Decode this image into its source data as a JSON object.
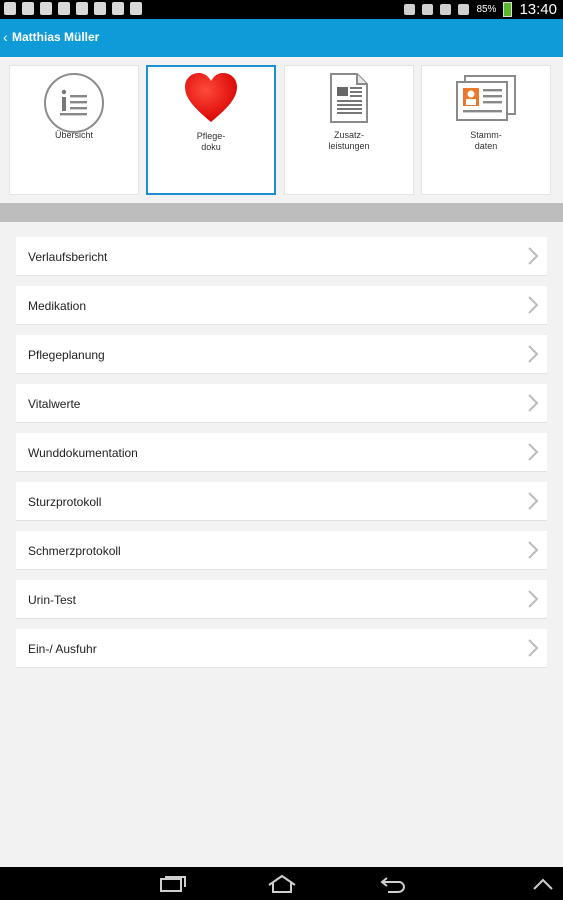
{
  "status_bar": {
    "battery_percent": "85%",
    "time": "13:40",
    "battery_color": "#5cb82b"
  },
  "header": {
    "title": "Matthias Müller",
    "background": "#0f9bd7"
  },
  "tiles": [
    {
      "label_lines": [
        "Übersicht"
      ],
      "icon": "info-list-icon",
      "selected": false
    },
    {
      "label_lines": [
        "Pflege-",
        "doku"
      ],
      "icon": "heart-icon",
      "selected": true
    },
    {
      "label_lines": [
        "Zusatz-",
        "leistungen"
      ],
      "icon": "document-icon",
      "selected": false
    },
    {
      "label_lines": [
        "Stamm-",
        "daten"
      ],
      "icon": "id-card-icon",
      "selected": false
    }
  ],
  "menu": {
    "items": [
      {
        "label": "Verlaufsbericht"
      },
      {
        "label": "Medikation"
      },
      {
        "label": "Pflegeplanung"
      },
      {
        "label": "Vitalwerte"
      },
      {
        "label": "Wunddokumentation"
      },
      {
        "label": "Sturzprotokoll"
      },
      {
        "label": "Schmerzprotokoll"
      },
      {
        "label": "Urin-Test"
      },
      {
        "label": "Ein-/ Ausfuhr"
      }
    ]
  }
}
